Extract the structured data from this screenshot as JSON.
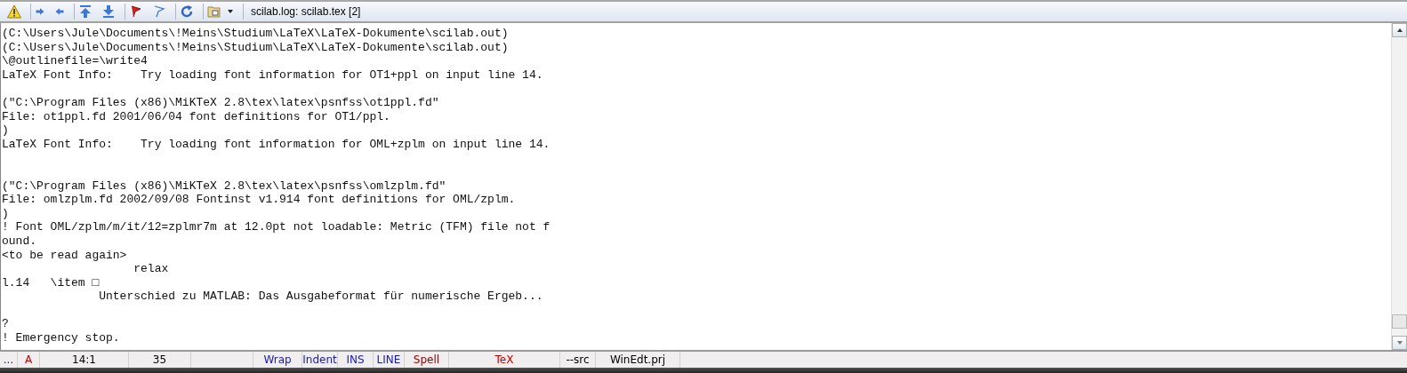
{
  "toolbar": {
    "title": "scilab.log: scilab.tex  [2]"
  },
  "log_lines": [
    {
      "kind": "text",
      "text": "(C:\\Users\\Jule\\Documents\\!Meins\\Studium\\LaTeX\\LaTeX-Dokumente\\scilab.out)"
    },
    {
      "kind": "text",
      "text": "(C:\\Users\\Jule\\Documents\\!Meins\\Studium\\LaTeX\\LaTeX-Dokumente\\scilab.out)"
    },
    {
      "kind": "text",
      "text": "\\@outlinefile=\\write4"
    },
    {
      "kind": "text",
      "text": "LaTeX Font Info:    Try loading font information for OT1+ppl on input line 14."
    },
    {
      "kind": "blank"
    },
    {
      "kind": "text",
      "text": "(\"C:\\Program Files (x86)\\MiKTeX 2.8\\tex\\latex\\psnfss\\ot1ppl.fd\""
    },
    {
      "kind": "text",
      "text": "File: ot1ppl.fd 2001/06/04 font definitions for OT1/ppl."
    },
    {
      "kind": "text",
      "text": ")"
    },
    {
      "kind": "text",
      "text": "LaTeX Font Info:    Try loading font information for OML+zplm on input line 14."
    },
    {
      "kind": "blank"
    },
    {
      "kind": "blank"
    },
    {
      "kind": "text",
      "text": "(\"C:\\Program Files (x86)\\MiKTeX 2.8\\tex\\latex\\psnfss\\omlzplm.fd\""
    },
    {
      "kind": "text",
      "text": "File: omlzplm.fd 2002/09/08 Fontinst v1.914 font definitions for OML/zplm."
    },
    {
      "kind": "text",
      "text": ")"
    },
    {
      "kind": "text",
      "text": "! Font OML/zplm/m/it/12=zplmr7m at 12.0pt not loadable: Metric (TFM) file not f"
    },
    {
      "kind": "text",
      "text": "ound."
    },
    {
      "kind": "text",
      "text": "<to be read again>"
    },
    {
      "kind": "text",
      "text": "                   relax"
    },
    {
      "kind": "text",
      "text": "l.14   \\item □"
    },
    {
      "kind": "text",
      "text": "              Unterschied zu MATLAB: Das Ausgabeformat für numerische Ergeb..."
    },
    {
      "kind": "blank"
    },
    {
      "kind": "text",
      "text": "?"
    },
    {
      "kind": "text",
      "text": "! Emergency stop."
    }
  ],
  "status_bar": [
    {
      "kind": "text",
      "text": "...",
      "color": "#1a1ab0"
    },
    {
      "kind": "text",
      "text": "A",
      "color": "#c00000"
    },
    {
      "kind": "text",
      "text": "14:1",
      "color": "#000000"
    },
    {
      "kind": "text",
      "text": "35",
      "color": "#000000"
    },
    {
      "kind": "blank"
    },
    {
      "kind": "text",
      "text": "Wrap",
      "color": "#1a1ab0"
    },
    {
      "kind": "text",
      "text": "Indent",
      "color": "#1a1ab0"
    },
    {
      "kind": "text",
      "text": "INS",
      "color": "#1a1ab0"
    },
    {
      "kind": "text",
      "text": "LINE",
      "color": "#1a1ab0"
    },
    {
      "kind": "text",
      "text": "Spell",
      "color": "#8b0000"
    },
    {
      "kind": "text",
      "text": "TeX",
      "color": "#c00000"
    },
    {
      "kind": "text",
      "text": "--src",
      "color": "#000000"
    },
    {
      "kind": "text",
      "text": "WinEdt.prj",
      "color": "#000000"
    }
  ]
}
